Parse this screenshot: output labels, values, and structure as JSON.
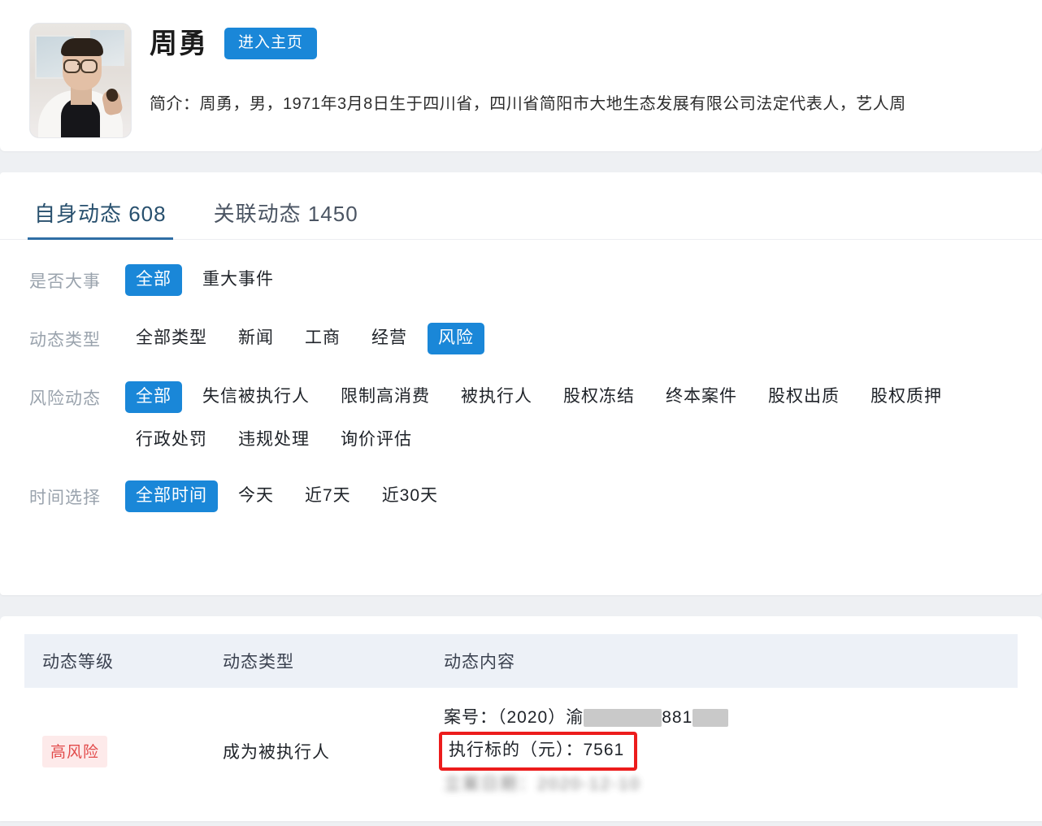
{
  "profile": {
    "name": "周勇",
    "home_button": "进入主页",
    "description": "简介：周勇，男，1971年3月8日生于四川省，四川省简阳市大地生态发展有限公司法定代表人，艺人周"
  },
  "tabs": [
    {
      "label": "自身动态 608",
      "active": true
    },
    {
      "label": "关联动态 1450",
      "active": false
    }
  ],
  "filters": [
    {
      "label": "是否大事",
      "chips": [
        {
          "label": "全部",
          "active": true
        },
        {
          "label": "重大事件",
          "active": false
        }
      ]
    },
    {
      "label": "动态类型",
      "chips": [
        {
          "label": "全部类型",
          "active": false
        },
        {
          "label": "新闻",
          "active": false
        },
        {
          "label": "工商",
          "active": false
        },
        {
          "label": "经营",
          "active": false
        },
        {
          "label": "风险",
          "active": true
        }
      ]
    },
    {
      "label": "风险动态",
      "chips": [
        {
          "label": "全部",
          "active": true
        },
        {
          "label": "失信被执行人",
          "active": false
        },
        {
          "label": "限制高消费",
          "active": false
        },
        {
          "label": "被执行人",
          "active": false
        },
        {
          "label": "股权冻结",
          "active": false
        },
        {
          "label": "终本案件",
          "active": false
        },
        {
          "label": "股权出质",
          "active": false
        },
        {
          "label": "股权质押",
          "active": false
        },
        {
          "label": "行政处罚",
          "active": false
        },
        {
          "label": "违规处理",
          "active": false
        },
        {
          "label": "询价评估",
          "active": false
        }
      ]
    },
    {
      "label": "时间选择",
      "chips": [
        {
          "label": "全部时间",
          "active": true
        },
        {
          "label": "今天",
          "active": false
        },
        {
          "label": "近7天",
          "active": false
        },
        {
          "label": "近30天",
          "active": false
        }
      ]
    }
  ],
  "table": {
    "headers": {
      "level": "动态等级",
      "type": "动态类型",
      "content": "动态内容"
    },
    "rows": [
      {
        "level": "高风险",
        "type": "成为被执行人",
        "case_label": "案号：",
        "case_prefix": "（2020）渝",
        "case_mid": "881",
        "amount_line": "执行标的（元）：7561",
        "blurred_line": "立案日期：2020-12-10"
      }
    ]
  },
  "colors": {
    "accent_blue": "#1a87d8",
    "tab_underline": "#2f6ea5",
    "risk_red": "#e24a4a",
    "risk_bg": "#fdeaea",
    "highlight_border": "#ec1c1c",
    "page_bg": "#eef0f3",
    "table_header_bg": "#edf1f7"
  }
}
